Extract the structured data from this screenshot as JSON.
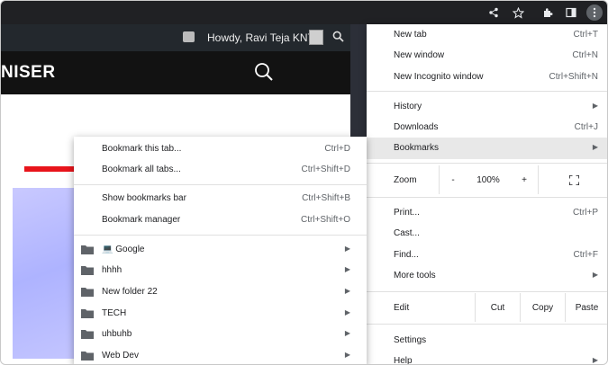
{
  "browser_toolbar": {
    "icons": [
      "share-icon",
      "star-icon",
      "extensions-icon",
      "sidebar-icon",
      "more-icon"
    ]
  },
  "site": {
    "greeting": "Howdy, Ravi Teja KNTS",
    "logo_text": "NISER"
  },
  "chrome_menu": {
    "new_tab": {
      "label": "New tab",
      "shortcut": "Ctrl+T"
    },
    "new_window": {
      "label": "New window",
      "shortcut": "Ctrl+N"
    },
    "new_incognito": {
      "label": "New Incognito window",
      "shortcut": "Ctrl+Shift+N"
    },
    "history": {
      "label": "History"
    },
    "downloads": {
      "label": "Downloads",
      "shortcut": "Ctrl+J"
    },
    "bookmarks": {
      "label": "Bookmarks"
    },
    "zoom": {
      "label": "Zoom",
      "minus": "-",
      "value": "100%",
      "plus": "+"
    },
    "print": {
      "label": "Print...",
      "shortcut": "Ctrl+P"
    },
    "cast": {
      "label": "Cast..."
    },
    "find": {
      "label": "Find...",
      "shortcut": "Ctrl+F"
    },
    "more_tools": {
      "label": "More tools"
    },
    "edit": {
      "label": "Edit",
      "cut": "Cut",
      "copy": "Copy",
      "paste": "Paste"
    },
    "settings": {
      "label": "Settings"
    },
    "help": {
      "label": "Help"
    }
  },
  "bookmarks_menu": {
    "bookmark_tab": {
      "label": "Bookmark this tab...",
      "shortcut": "Ctrl+D"
    },
    "bookmark_all": {
      "label": "Bookmark all tabs...",
      "shortcut": "Ctrl+Shift+D"
    },
    "show_bar": {
      "label": "Show bookmarks bar",
      "shortcut": "Ctrl+Shift+B"
    },
    "manager": {
      "label": "Bookmark manager",
      "shortcut": "Ctrl+Shift+O"
    },
    "folders": [
      {
        "label": "💻 Google"
      },
      {
        "label": "hhhh"
      },
      {
        "label": "New folder 22"
      },
      {
        "label": "TECH"
      },
      {
        "label": "uhbuhb"
      },
      {
        "label": "Web Dev"
      }
    ]
  },
  "colors": {
    "toolbar_bg": "#202124",
    "annotation_arrow": "#e8141b",
    "highlight_row": "#e8e8e8"
  }
}
